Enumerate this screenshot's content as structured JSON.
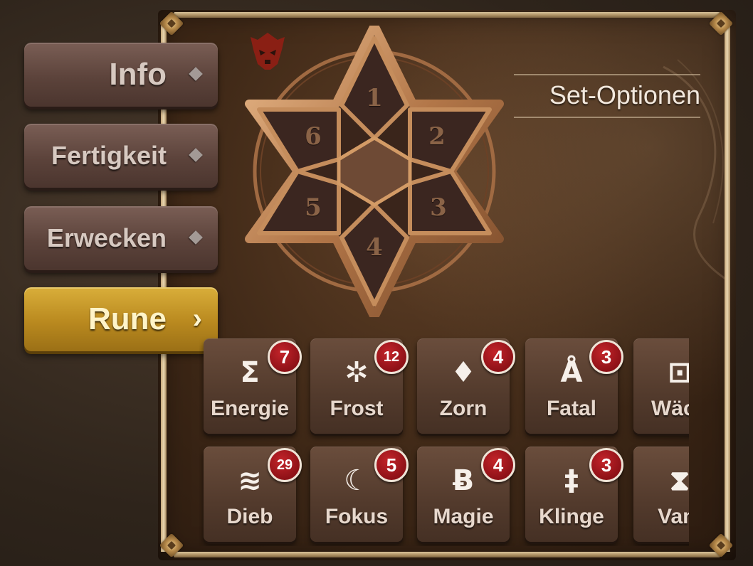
{
  "tabs": {
    "info": "Info",
    "skill": "Fertigkeit",
    "awaken": "Erwecken",
    "rune": "Rune",
    "rune_chevron": "›"
  },
  "star": {
    "slots": [
      "1",
      "2",
      "3",
      "4",
      "5",
      "6"
    ]
  },
  "set_options": "Set-Optionen",
  "rune_sets": [
    {
      "name": "Energie",
      "count": "7",
      "glyph": "Σ"
    },
    {
      "name": "Frost",
      "count": "12",
      "glyph": "✲"
    },
    {
      "name": "Zorn",
      "count": "4",
      "glyph": "♦"
    },
    {
      "name": "Fatal",
      "count": "3",
      "glyph": "Å"
    },
    {
      "name": "Wäch",
      "count": "",
      "glyph": "⊡"
    },
    {
      "name": "Dieb",
      "count": "29",
      "glyph": "≋"
    },
    {
      "name": "Fokus",
      "count": "5",
      "glyph": "☾"
    },
    {
      "name": "Magie",
      "count": "4",
      "glyph": "Ƀ"
    },
    {
      "name": "Klinge",
      "count": "3",
      "glyph": "‡"
    },
    {
      "name": "Vam",
      "count": "",
      "glyph": "⧗"
    }
  ],
  "colors": {
    "active_tab": "#b9891f",
    "tab": "#5c433b",
    "badge": "#a5161d",
    "panel": "#3d2716"
  }
}
